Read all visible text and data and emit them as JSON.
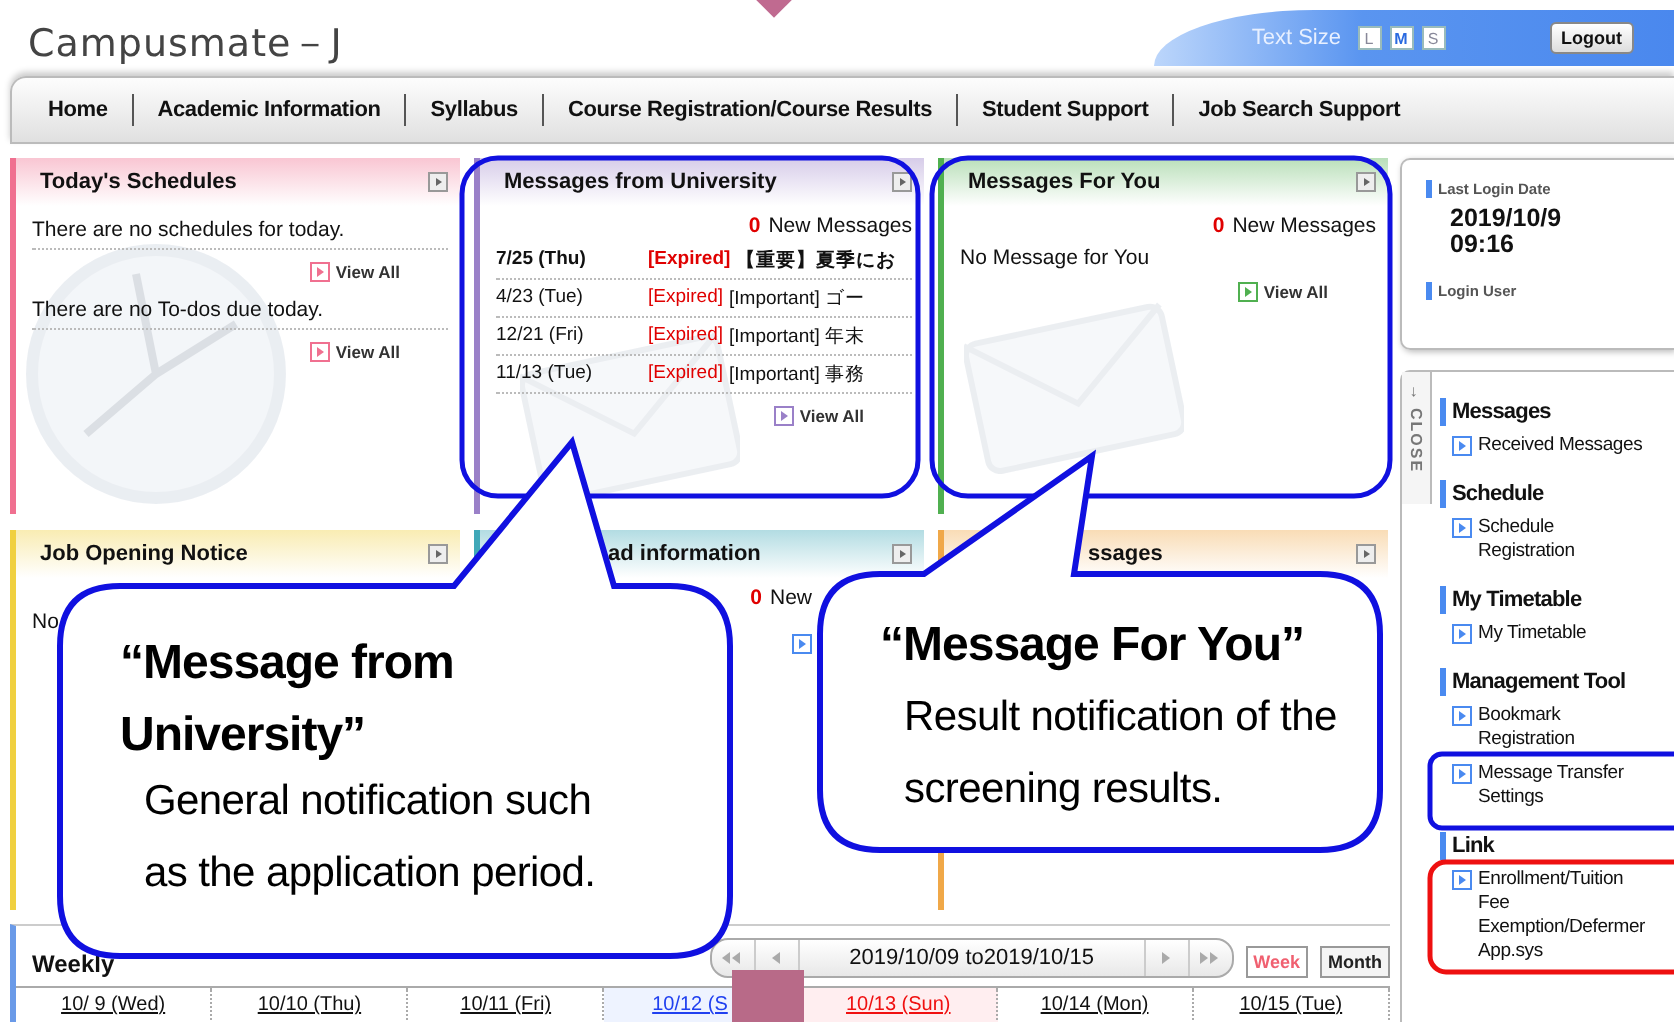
{
  "header": {
    "logo": "Campusmate－J",
    "text_size_label": "Text Size",
    "text_sizes": [
      {
        "label": "L",
        "selected": false
      },
      {
        "label": "M",
        "selected": true
      },
      {
        "label": "S",
        "selected": false
      }
    ],
    "logout": "Logout"
  },
  "nav": [
    "Home",
    "Academic Information",
    "Syllabus",
    "Course Registration/Course Results",
    "Student Support",
    "Job Search Support"
  ],
  "panels": [
    {
      "kind": "schedules",
      "title": "Today's Schedules",
      "color": "#f07090",
      "blocks": [
        {
          "text": "There are no schedules for today.",
          "link": "View All"
        },
        {
          "text": "There are no To-dos due today.",
          "link": "View All"
        }
      ]
    },
    {
      "kind": "messages",
      "title": "Messages from University",
      "color": "#9a80c8",
      "new_count": "0",
      "new_label": "New Messages",
      "rows": [
        {
          "date": "7/25 (Thu)",
          "status": "[Expired]",
          "subject": "【重要】夏季にお",
          "unread": true
        },
        {
          "date": "4/23 (Tue)",
          "status": "[Expired]",
          "subject": "[Important] ゴー",
          "unread": false
        },
        {
          "date": "12/21 (Fri)",
          "status": "[Expired]",
          "subject": "[Important] 年末",
          "unread": false
        },
        {
          "date": "11/13 (Tue)",
          "status": "[Expired]",
          "subject": "[Important] 事務",
          "unread": false
        }
      ],
      "link": "View All"
    },
    {
      "kind": "messages",
      "title": "Messages For You",
      "color": "#50b050",
      "new_count": "0",
      "new_label": "New Messages",
      "empty": "No Message for You",
      "link": "View All"
    },
    {
      "kind": "notice",
      "title": "Job Opening Notice",
      "color": "#f0d040",
      "text": "No"
    },
    {
      "kind": "messages",
      "title": "ad information",
      "color": "#40a8b8",
      "new_count": "0",
      "new_label": "New"
    },
    {
      "kind": "notice",
      "title": "ssages",
      "color": "#f0a848"
    }
  ],
  "weekly": {
    "title": "Weekly",
    "range": "2019/10/09 to2019/10/15",
    "views": [
      {
        "label": "Week",
        "selected": true
      },
      {
        "label": "Month",
        "selected": false
      }
    ],
    "days": [
      {
        "label": "10/ 9 (Wed)",
        "kind": "weekday"
      },
      {
        "label": "10/10 (Thu)",
        "kind": "weekday"
      },
      {
        "label": "10/11 (Fri)",
        "kind": "weekday"
      },
      {
        "label": "10/12 (S",
        "kind": "saturday"
      },
      {
        "label": "10/13 (Sun)",
        "kind": "sunday"
      },
      {
        "label": "10/14 (Mon)",
        "kind": "weekday"
      },
      {
        "label": "10/15 (Tue)",
        "kind": "weekday"
      }
    ]
  },
  "login": {
    "date_label": "Last Login Date",
    "date": "2019/10/9",
    "time": "09:16",
    "user_label": "Login User"
  },
  "menu": {
    "close_arrow": "→",
    "close": "CLOSE",
    "sections": [
      {
        "title": "Messages",
        "items": [
          "Received Messages"
        ]
      },
      {
        "title": "Schedule",
        "items": [
          "Schedule\nRegistration"
        ]
      },
      {
        "title": "My Timetable",
        "items": [
          "My Timetable"
        ]
      },
      {
        "title": "Management Tool",
        "items": [
          "Bookmark\nRegistration",
          "Message Transfer\nSettings"
        ]
      },
      {
        "title": "Link",
        "items": [
          "Enrollment/Tuition\nFee\nExemption/Defermer\nApp.sys"
        ]
      }
    ]
  },
  "callouts": [
    {
      "title": "“Message from University”",
      "body": "General notification such as the application period."
    },
    {
      "title": "“Message For You”",
      "body": "Result notification of the screening results."
    }
  ]
}
